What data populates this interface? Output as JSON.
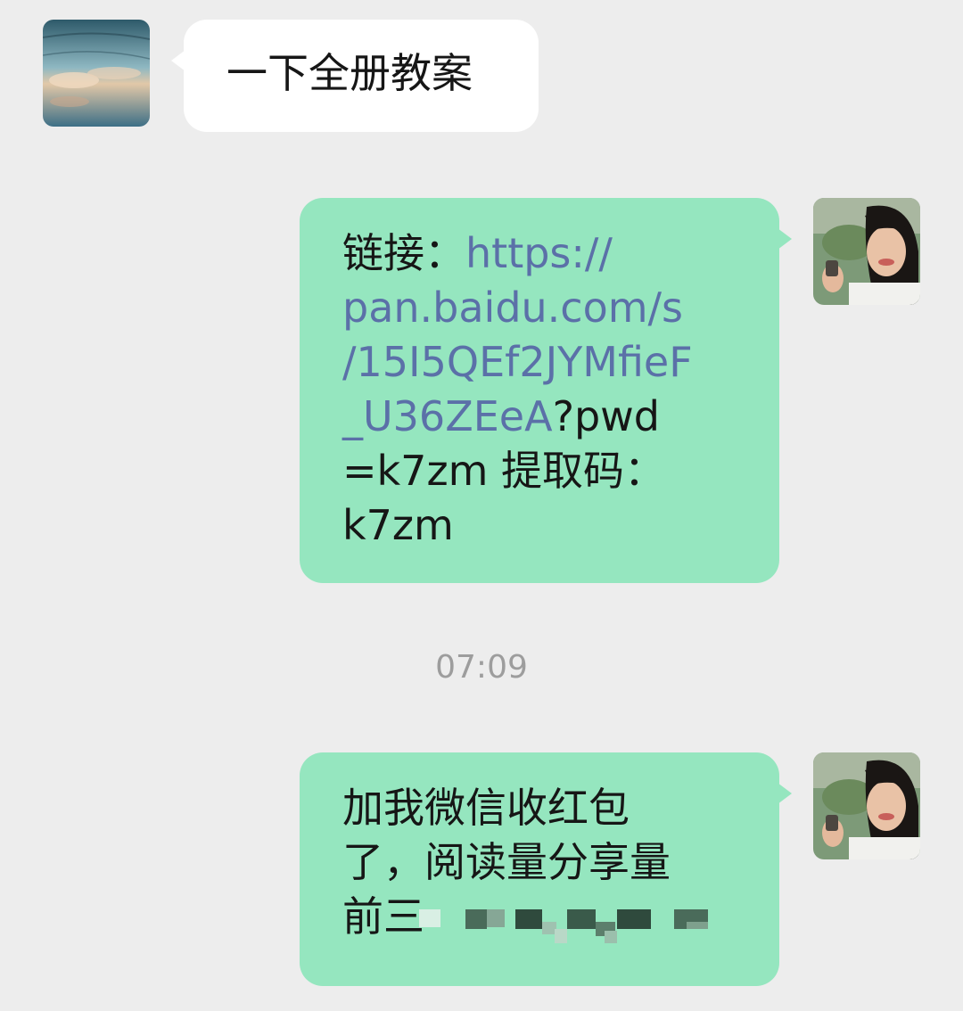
{
  "messages": [
    {
      "sender": "contact",
      "text": "一下全册教案"
    },
    {
      "sender": "self",
      "link_prefix": "链接：",
      "link_lines": [
        "https://",
        "pan.baidu.com/s",
        "/15I5QEf2JYMfieF",
        "_U36ZEeA"
      ],
      "after_link": "?pwd",
      "line5": "=k7zm 提取码：",
      "line6": "k7zm"
    },
    {
      "sender": "self",
      "lines": [
        "加我微信收红包",
        "了，阅读量分享量",
        "前三"
      ],
      "censored": true
    }
  ],
  "timestamp": "07:09",
  "colors": {
    "background": "#ededed",
    "incoming_bubble": "#ffffff",
    "outgoing_bubble": "#95e6bf",
    "link": "#5b70a8"
  }
}
